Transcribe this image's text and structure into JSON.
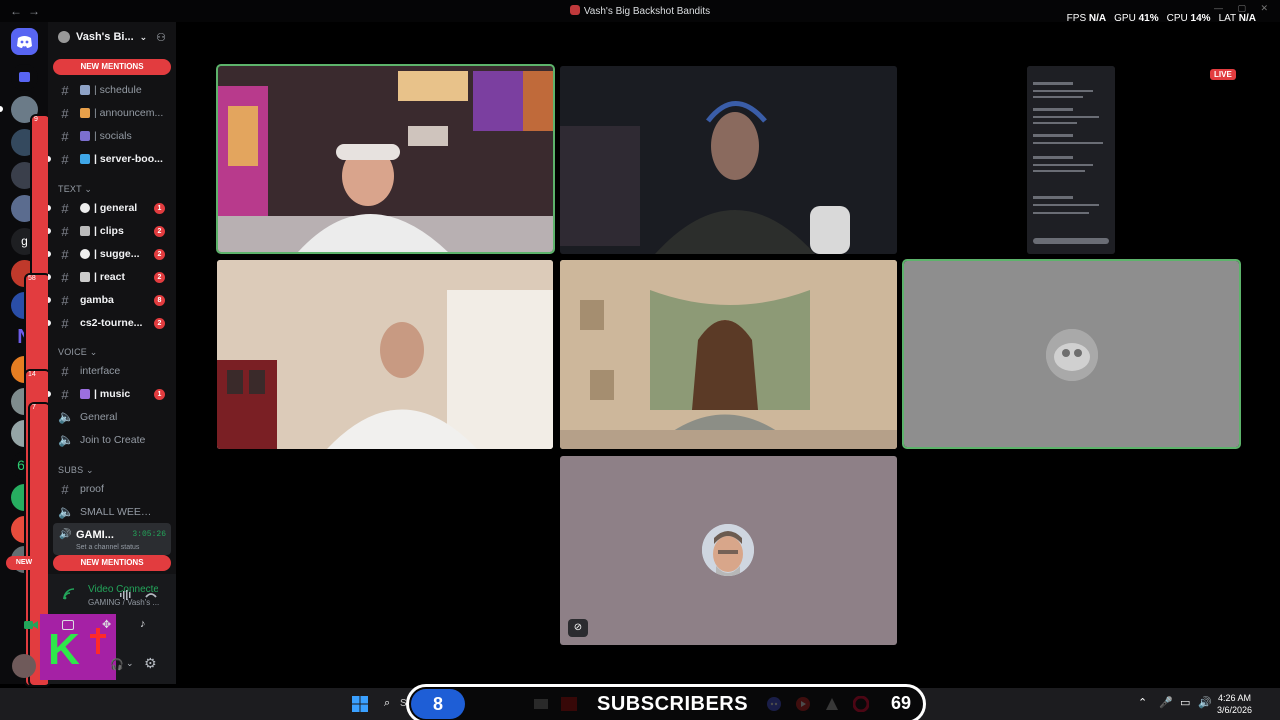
{
  "window": {
    "title": "Vash's Big Backshot Bandits",
    "nav_back": "←",
    "nav_fwd": "→",
    "controls": "— ▢ ✕"
  },
  "perf": {
    "fps_label": "FPS",
    "fps_val": "N/A",
    "gpu_label": "GPU",
    "gpu_val": "41",
    "cpu_label": "CPU",
    "cpu_val": "14",
    "lat_label": "LAT",
    "lat_val": "N/A",
    "pct": "%"
  },
  "server": {
    "name": "Vash's Bi...",
    "new_mentions": "NEW MENTIONS",
    "new_short": "NEW"
  },
  "channels_top": [
    {
      "name": "| schedule"
    },
    {
      "name": "| announcem..."
    },
    {
      "name": "| socials"
    },
    {
      "name": "| server-boo..."
    }
  ],
  "categories": {
    "text": "TEXT",
    "voice": "VOICE",
    "subs": "SUBS"
  },
  "text_channels": [
    {
      "name": "| general",
      "count": "1"
    },
    {
      "name": "| clips",
      "count": "2"
    },
    {
      "name": "| sugge...",
      "count": "2"
    },
    {
      "name": "| react",
      "count": "2"
    },
    {
      "name": "gamba",
      "count": "8"
    },
    {
      "name": "cs2-tourne...",
      "count": "2"
    }
  ],
  "voice_channels": [
    {
      "name": "interface"
    },
    {
      "name": "| music",
      "count": "1"
    },
    {
      "name": "General"
    },
    {
      "name": "Join to Create"
    }
  ],
  "subs_channels": [
    {
      "name": "proof"
    },
    {
      "name": "SMALL WEENS ..."
    }
  ],
  "active_voice": {
    "name": "GAMI...",
    "timer": "3:05:26",
    "status": "Set a channel status"
  },
  "rail_badges": [
    "9",
    "58",
    "14",
    "7"
  ],
  "voice_panel": {
    "connection": "Video Connected",
    "location": "GAMING / Vash's ..."
  },
  "stream": {
    "live": "LIVE"
  },
  "overlay": {
    "current": "8",
    "label": "SUBSCRIBERS",
    "goal": "69"
  },
  "taskbar": {
    "search": "S",
    "time": "4:26 AM",
    "date": "3/6/2026"
  },
  "colors": {
    "accent_red": "#e23c3f",
    "speaking_green": "#5db36b",
    "connected_green": "#23a55a"
  }
}
